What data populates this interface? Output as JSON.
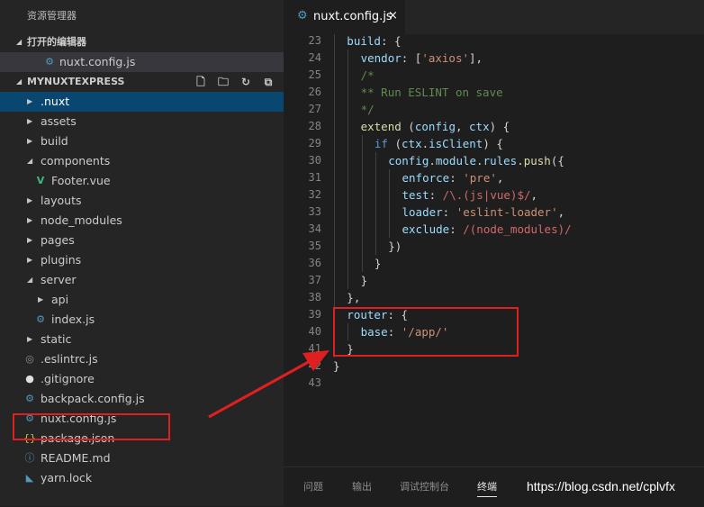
{
  "sidebar": {
    "title": "资源管理器",
    "open_editors_label": "打开的编辑器",
    "open_editors": [
      {
        "label": "nuxt.config.js",
        "icon": "gear-icon"
      }
    ],
    "project_label": "MYNUXTEXPRESS",
    "actions": [
      "new-file-icon",
      "new-folder-icon",
      "refresh-icon",
      "collapse-all-icon"
    ],
    "tree": [
      {
        "label": ".nuxt",
        "type": "folder",
        "expanded": false,
        "depth": 0,
        "selected": true
      },
      {
        "label": "assets",
        "type": "folder",
        "expanded": false,
        "depth": 0
      },
      {
        "label": "build",
        "type": "folder",
        "expanded": false,
        "depth": 0
      },
      {
        "label": "components",
        "type": "folder",
        "expanded": true,
        "depth": 0
      },
      {
        "label": "Footer.vue",
        "type": "file",
        "icon": "vue-icon",
        "depth": 1
      },
      {
        "label": "layouts",
        "type": "folder",
        "expanded": false,
        "depth": 0
      },
      {
        "label": "node_modules",
        "type": "folder",
        "expanded": false,
        "depth": 0
      },
      {
        "label": "pages",
        "type": "folder",
        "expanded": false,
        "depth": 0
      },
      {
        "label": "plugins",
        "type": "folder",
        "expanded": false,
        "depth": 0
      },
      {
        "label": "server",
        "type": "folder",
        "expanded": true,
        "depth": 0
      },
      {
        "label": "api",
        "type": "folder",
        "expanded": false,
        "depth": 1
      },
      {
        "label": "index.js",
        "type": "file",
        "icon": "gear-icon",
        "depth": 1
      },
      {
        "label": "static",
        "type": "folder",
        "expanded": false,
        "depth": 0
      },
      {
        "label": ".eslintrc.js",
        "type": "file",
        "icon": "circle-icon",
        "depth": 0
      },
      {
        "label": ".gitignore",
        "type": "file",
        "icon": "github-icon",
        "depth": 0
      },
      {
        "label": "backpack.config.js",
        "type": "file",
        "icon": "gear-icon",
        "depth": 0
      },
      {
        "label": "nuxt.config.js",
        "type": "file",
        "icon": "gear-icon",
        "depth": 0,
        "outlined": true
      },
      {
        "label": "package.json",
        "type": "file",
        "icon": "braces-icon",
        "depth": 0
      },
      {
        "label": "README.md",
        "type": "file",
        "icon": "info-icon",
        "depth": 0
      },
      {
        "label": "yarn.lock",
        "type": "file",
        "icon": "yarn-icon",
        "depth": 0
      }
    ]
  },
  "editor": {
    "tab_label": "nuxt.config.js",
    "tab_close": "×",
    "lines": [
      {
        "n": "23",
        "indent": 1,
        "parts": [
          [
            "k",
            "build"
          ],
          [
            "p",
            ": {"
          ]
        ]
      },
      {
        "n": "24",
        "indent": 2,
        "parts": [
          [
            "k",
            "vendor"
          ],
          [
            "p",
            ": ["
          ],
          [
            "s",
            "'axios'"
          ],
          [
            "p",
            "],"
          ]
        ]
      },
      {
        "n": "25",
        "indent": 2,
        "parts": [
          [
            "c",
            "/*"
          ]
        ]
      },
      {
        "n": "26",
        "indent": 2,
        "parts": [
          [
            "c",
            "** Run ESLINT on save"
          ]
        ]
      },
      {
        "n": "27",
        "indent": 2,
        "parts": [
          [
            "c",
            "*/"
          ]
        ]
      },
      {
        "n": "28",
        "indent": 2,
        "parts": [
          [
            "fn",
            "extend"
          ],
          [
            "p",
            " ("
          ],
          [
            "k",
            "config"
          ],
          [
            "p",
            ", "
          ],
          [
            "k",
            "ctx"
          ],
          [
            "p",
            ") {"
          ]
        ]
      },
      {
        "n": "29",
        "indent": 3,
        "parts": [
          [
            "cf",
            "if"
          ],
          [
            "p",
            " ("
          ],
          [
            "k",
            "ctx"
          ],
          [
            "p",
            "."
          ],
          [
            "k",
            "isClient"
          ],
          [
            "p",
            ") {"
          ]
        ]
      },
      {
        "n": "30",
        "indent": 4,
        "parts": [
          [
            "k",
            "config"
          ],
          [
            "p",
            "."
          ],
          [
            "k",
            "module"
          ],
          [
            "p",
            "."
          ],
          [
            "k",
            "rules"
          ],
          [
            "p",
            "."
          ],
          [
            "fn",
            "push"
          ],
          [
            "p",
            "({"
          ]
        ]
      },
      {
        "n": "31",
        "indent": 5,
        "parts": [
          [
            "k",
            "enforce"
          ],
          [
            "p",
            ": "
          ],
          [
            "s",
            "'pre'"
          ],
          [
            "p",
            ","
          ]
        ]
      },
      {
        "n": "32",
        "indent": 5,
        "parts": [
          [
            "k",
            "test"
          ],
          [
            "p",
            ": "
          ],
          [
            "re",
            "/\\.(js|vue)$/"
          ],
          [
            "p",
            ","
          ]
        ]
      },
      {
        "n": "33",
        "indent": 5,
        "parts": [
          [
            "k",
            "loader"
          ],
          [
            "p",
            ": "
          ],
          [
            "s",
            "'eslint-loader'"
          ],
          [
            "p",
            ","
          ]
        ]
      },
      {
        "n": "34",
        "indent": 5,
        "parts": [
          [
            "k",
            "exclude"
          ],
          [
            "p",
            ": "
          ],
          [
            "re",
            "/(node_modules)/"
          ]
        ]
      },
      {
        "n": "35",
        "indent": 4,
        "parts": [
          [
            "p",
            "})"
          ]
        ]
      },
      {
        "n": "36",
        "indent": 3,
        "parts": [
          [
            "p",
            "}"
          ]
        ]
      },
      {
        "n": "37",
        "indent": 2,
        "parts": [
          [
            "p",
            "}"
          ]
        ]
      },
      {
        "n": "38",
        "indent": 1,
        "parts": [
          [
            "p",
            "},"
          ]
        ]
      },
      {
        "n": "39",
        "indent": 1,
        "parts": [
          [
            "k",
            "router"
          ],
          [
            "p",
            ": {"
          ]
        ]
      },
      {
        "n": "40",
        "indent": 2,
        "parts": [
          [
            "k",
            "base"
          ],
          [
            "p",
            ": "
          ],
          [
            "s",
            "'/app/'"
          ]
        ]
      },
      {
        "n": "41",
        "indent": 1,
        "parts": [
          [
            "p",
            "}"
          ]
        ]
      },
      {
        "n": "42",
        "indent": 0,
        "parts": [
          [
            "p",
            "}"
          ]
        ]
      },
      {
        "n": "43",
        "indent": 0,
        "parts": []
      }
    ]
  },
  "panel": {
    "tabs": [
      {
        "label": "问题",
        "active": false
      },
      {
        "label": "输出",
        "active": false
      },
      {
        "label": "调试控制台",
        "active": false
      },
      {
        "label": "终端",
        "active": true
      }
    ]
  },
  "watermark": "https://blog.csdn.net/cplvfx",
  "colors": {
    "accent_red": "#e02020",
    "selection": "#094771",
    "vue_green": "#41b883",
    "gear_blue": "#519aba"
  }
}
